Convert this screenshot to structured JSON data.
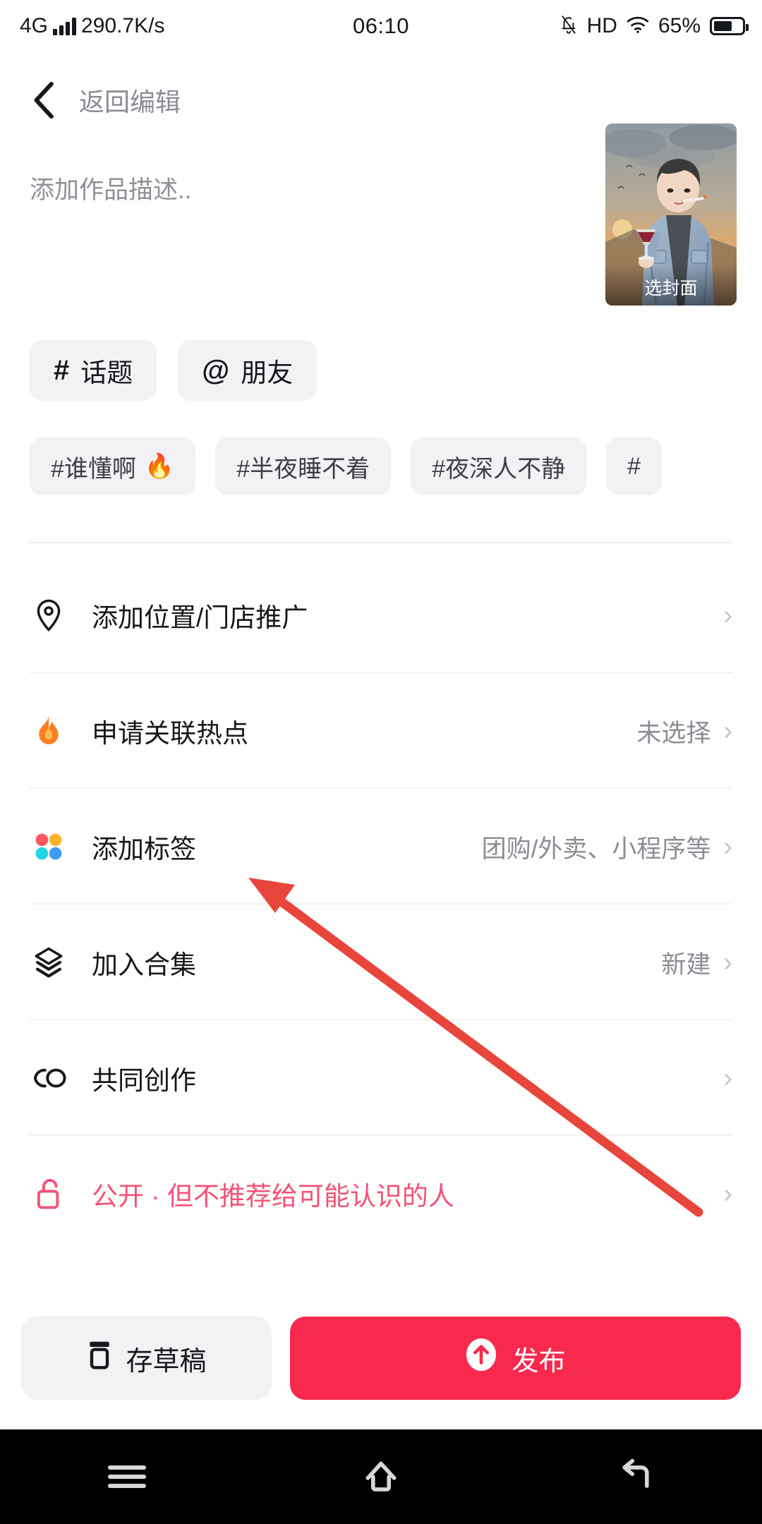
{
  "status_bar": {
    "network_type": "4G",
    "speed": "290.7K/s",
    "time": "06:10",
    "hd": "HD",
    "battery_percent": "65%",
    "icons": [
      "signal-bars-icon",
      "mute-icon",
      "hd-icon",
      "wifi-icon",
      "battery-icon"
    ]
  },
  "nav": {
    "back_icon": "chevron-left-icon",
    "back_label": "返回编辑"
  },
  "description": {
    "placeholder": "添加作品描述..",
    "value": ""
  },
  "cover": {
    "label": "选封面"
  },
  "insert_chips": [
    {
      "symbol": "#",
      "label": "话题",
      "icon": "hash-icon"
    },
    {
      "symbol": "@",
      "label": "朋友",
      "icon": "at-icon"
    }
  ],
  "suggestions": [
    {
      "label": "#谁懂啊",
      "emoji": "🔥"
    },
    {
      "label": "#半夜睡不着",
      "emoji": ""
    },
    {
      "label": "#夜深人不静",
      "emoji": ""
    },
    {
      "label": "#",
      "emoji": ""
    }
  ],
  "options": [
    {
      "icon": "location-pin-icon",
      "label": "添加位置/门店推广",
      "value": "",
      "chevron": "›"
    },
    {
      "icon": "flame-icon",
      "label": "申请关联热点",
      "value": "未选择",
      "chevron": "›"
    },
    {
      "icon": "four-dots-icon",
      "label": "添加标签",
      "value": "团购/外卖、小程序等",
      "chevron": "›"
    },
    {
      "icon": "layers-icon",
      "label": "加入合集",
      "value": "新建",
      "chevron": "›"
    },
    {
      "icon": "co-create-icon",
      "label": "共同创作",
      "value": "",
      "chevron": "›"
    },
    {
      "icon": "unlock-icon",
      "label": "公开 · 但不推荐给可能认识的人",
      "value": "",
      "chevron": "›"
    }
  ],
  "actions": {
    "draft_label": "存草稿",
    "draft_icon": "draft-box-icon",
    "publish_label": "发布",
    "publish_icon": "upload-arrow-icon"
  },
  "android_nav": {
    "recents_icon": "menu-icon",
    "home_icon": "home-icon",
    "back_icon": "back-icon"
  },
  "colors": {
    "publish_red": "#f8294d",
    "privacy_pink": "#f2527a",
    "chip_bg": "#f2f2f4",
    "muted_text": "#8a8d94",
    "annotation_red": "#e8453c"
  }
}
